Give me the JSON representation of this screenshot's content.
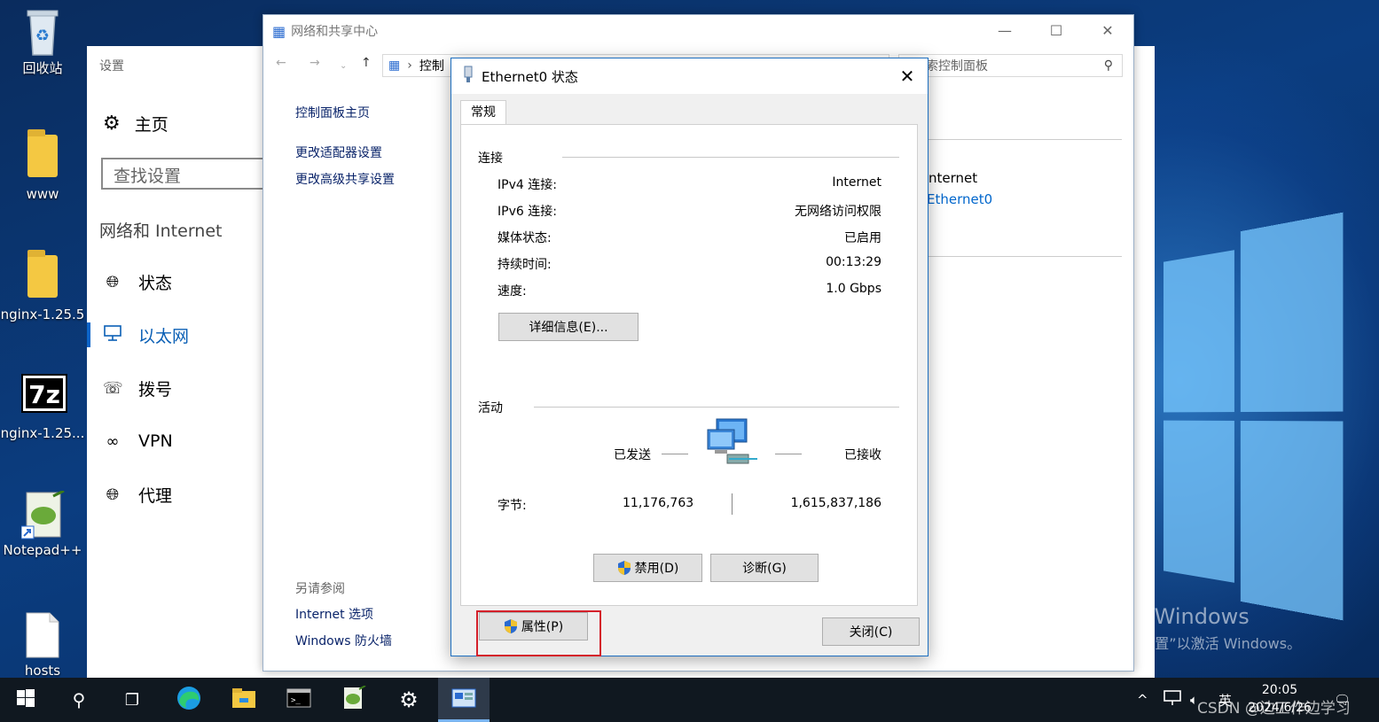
{
  "desktop": {
    "icons": [
      {
        "label": "回收站"
      },
      {
        "label": "www"
      },
      {
        "label": "nginx-1.25.5"
      },
      {
        "label": "nginx-1.25..."
      },
      {
        "label": "Notepad++"
      },
      {
        "label": "hosts"
      }
    ],
    "activation": {
      "line1": "激活 Windows",
      "line2": "转到“设置”以激活 Windows。"
    }
  },
  "settings": {
    "title": "设置",
    "home": "主页",
    "search_placeholder": "查找设置",
    "category": "网络和 Internet",
    "nav": [
      {
        "label": "状态",
        "icon": "globe-icon"
      },
      {
        "label": "以太网",
        "icon": "ethernet-icon",
        "active": true
      },
      {
        "label": "拨号",
        "icon": "dialup-icon"
      },
      {
        "label": "VPN",
        "icon": "vpn-icon"
      },
      {
        "label": "代理",
        "icon": "proxy-globe-icon"
      }
    ]
  },
  "netcenter": {
    "title": "网络和共享中心",
    "address": "控制",
    "search_placeholder": "索控制面板",
    "links": [
      "控制面板主页",
      "更改适配器设置",
      "更改高级共享设置"
    ],
    "see_also": "另请参阅",
    "see_also_links": [
      "Internet 选项",
      "Windows 防火墙"
    ],
    "right_access": "nternet",
    "right_connection": "Ethernet0"
  },
  "dialog": {
    "title": "Ethernet0 状态",
    "tab": "常规",
    "connection_group": "连接",
    "rows": [
      {
        "label": "IPv4 连接:",
        "value": "Internet"
      },
      {
        "label": "IPv6 连接:",
        "value": "无网络访问权限"
      },
      {
        "label": "媒体状态:",
        "value": "已启用"
      },
      {
        "label": "持续时间:",
        "value": "00:13:29"
      },
      {
        "label": "速度:",
        "value": "1.0 Gbps"
      }
    ],
    "details_button": "详细信息(E)...",
    "activity_group": "活动",
    "sent_label": "已发送",
    "received_label": "已接收",
    "bytes_label": "字节:",
    "bytes_sent": "11,176,763",
    "bytes_received": "1,615,837,186",
    "properties_button": "属性(P)",
    "disable_button": "禁用(D)",
    "diagnose_button": "诊断(G)",
    "close_button": "关闭(C)"
  },
  "taskbar": {
    "ime": "英",
    "time": "20:05",
    "date": "2024/6/26",
    "watermark": "CSDN @边工作边学习"
  }
}
